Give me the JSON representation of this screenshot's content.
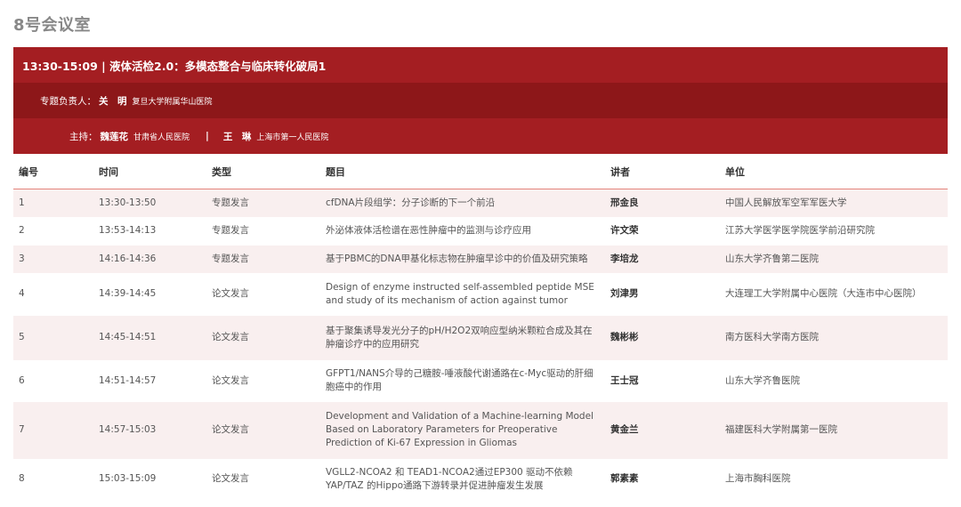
{
  "room": {
    "title": "8号会议室"
  },
  "session": {
    "title": "13:30-15:09 | 液体活检2.0：多模态整合与临床转化破局1",
    "chair_label": "专题负责人：",
    "chair_name": "关　明",
    "chair_institution": "复旦大学附属华山医院",
    "host_label": "主持：",
    "host1_name": "魏莲花",
    "host1_institution": "甘肃省人民医院",
    "separator": "|",
    "host2_name": "王　琳",
    "host2_institution": "上海市第一人民医院"
  },
  "table": {
    "headers": {
      "no": "编号",
      "time": "时间",
      "type": "类型",
      "topic": "题目",
      "speaker": "讲者",
      "unit": "单位"
    },
    "rows": [
      {
        "no": "1",
        "time": "13:30-13:50",
        "type": "专题发言",
        "topic": "cfDNA片段组学：分子诊断的下一个前沿",
        "speaker": "邢金良",
        "unit": "中国人民解放军空军军医大学"
      },
      {
        "no": "2",
        "time": "13:53-14:13",
        "type": "专题发言",
        "topic": "外泌体液体活检谱在恶性肿瘤中的监测与诊疗应用",
        "speaker": "许文荣",
        "unit": "江苏大学医学医学院医学前沿研究院"
      },
      {
        "no": "3",
        "time": "14:16-14:36",
        "type": "专题发言",
        "topic": "基于PBMC的DNA甲基化标志物在肿瘤早诊中的价值及研究策略",
        "speaker": "李培龙",
        "unit": "山东大学齐鲁第二医院"
      },
      {
        "no": "4",
        "time": "14:39-14:45",
        "type": "论文发言",
        "topic": "Design of enzyme instructed self-assembled peptide MSE and study of its mechanism of action against tumor",
        "speaker": "刘津男",
        "unit": "大连理工大学附属中心医院（大连市中心医院）"
      },
      {
        "no": "5",
        "time": "14:45-14:51",
        "type": "论文发言",
        "topic": "基于聚集诱导发光分子的pH/H2O2双响应型纳米颗粒合成及其在肿瘤诊疗中的应用研究",
        "speaker": "魏彬彬",
        "unit": "南方医科大学南方医院"
      },
      {
        "no": "6",
        "time": "14:51-14:57",
        "type": "论文发言",
        "topic": "GFPT1/NANS介导的己糖胺-唾液酸代谢通路在c-Myc驱动的肝细胞癌中的作用",
        "speaker": "王士冠",
        "unit": "山东大学齐鲁医院"
      },
      {
        "no": "7",
        "time": "14:57-15:03",
        "type": "论文发言",
        "topic": "Development and Validation of a Machine-learning Model Based on Laboratory Parameters for Preoperative Prediction of Ki-67 Expression in Gliomas",
        "speaker": "黄金兰",
        "unit": "福建医科大学附属第一医院"
      },
      {
        "no": "8",
        "time": "15:03-15:09",
        "type": "论文发言",
        "topic": "VGLL2-NCOA2 和 TEAD1-NCOA2通过EP300 驱动不依赖YAP/TAZ 的Hippo通路下游转录并促进肿瘤发生发展",
        "speaker": "郭素素",
        "unit": "上海市胸科医院"
      }
    ]
  },
  "colors": {
    "session_bar": "#a41e22",
    "chair_bar": "#8d1719",
    "row_stripe": "#f9efef",
    "header_rule": "#e4847c"
  }
}
